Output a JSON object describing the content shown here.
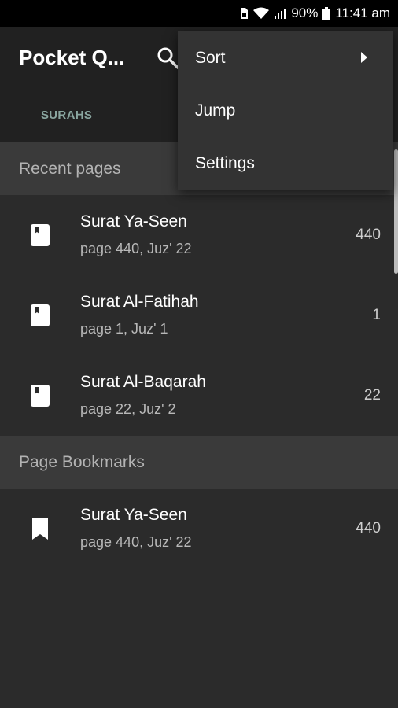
{
  "status_bar": {
    "battery": "90%",
    "time": "11:41 am"
  },
  "app_bar": {
    "title": "Pocket Q...",
    "tabs": [
      {
        "label": "SURAHS"
      }
    ]
  },
  "overflow_menu": {
    "items": [
      {
        "label": "Sort",
        "has_submenu": true
      },
      {
        "label": "Jump"
      },
      {
        "label": "Settings"
      }
    ]
  },
  "sections": {
    "recent": {
      "header": "Recent pages",
      "items": [
        {
          "title": "Surat Ya-Seen",
          "subtitle": "page 440, Juz' 22",
          "page": "440"
        },
        {
          "title": "Surat Al-Fatihah",
          "subtitle": "page 1, Juz' 1",
          "page": "1"
        },
        {
          "title": "Surat Al-Baqarah",
          "subtitle": "page 22, Juz' 2",
          "page": "22"
        }
      ]
    },
    "bookmarks": {
      "header": "Page Bookmarks",
      "items": [
        {
          "title": "Surat Ya-Seen",
          "subtitle": "page 440, Juz' 22",
          "page": "440"
        }
      ]
    }
  },
  "colors": {
    "background": "#2b2b2b",
    "app_bar": "#212121",
    "section_header": "#3a3a3a",
    "menu": "#333333",
    "tab_accent": "#8aa6a0"
  },
  "icons": {
    "recent_item": "book-page-icon",
    "bookmark_item": "bookmark-icon",
    "search": "search-icon",
    "submenu": "chevron-right-icon"
  }
}
